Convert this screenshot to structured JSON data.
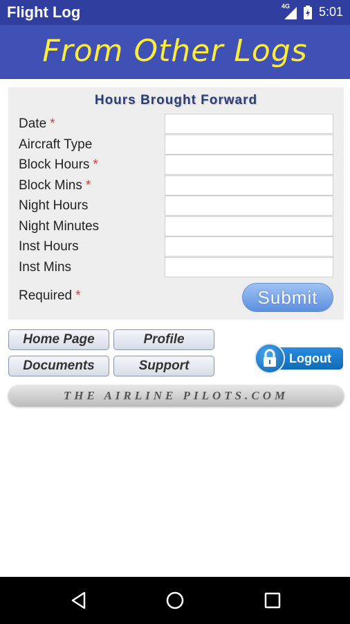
{
  "status_bar": {
    "app_title": "Flight Log",
    "network": "4G",
    "time": "5:01"
  },
  "banner": {
    "title": "From Other Logs"
  },
  "form": {
    "heading": "Hours Brought Forward",
    "fields": [
      {
        "label": "Date",
        "required_mark": "*",
        "value": ""
      },
      {
        "label": "Aircraft Type",
        "required_mark": "",
        "value": ""
      },
      {
        "label": "Block Hours",
        "required_mark": "*",
        "value": ""
      },
      {
        "label": "Block Mins",
        "required_mark": "*",
        "value": ""
      },
      {
        "label": "Night Hours",
        "required_mark": "",
        "value": ""
      },
      {
        "label": "Night Minutes",
        "required_mark": "",
        "value": ""
      },
      {
        "label": "Inst Hours",
        "required_mark": "",
        "value": ""
      },
      {
        "label": "Inst Mins",
        "required_mark": "",
        "value": ""
      }
    ],
    "required_note": "Required",
    "required_mark": "*",
    "submit_label": "Submit"
  },
  "nav": {
    "home": "Home Page",
    "profile": "Profile",
    "documents": "Documents",
    "support": "Support",
    "logout": "Logout"
  },
  "brand": {
    "text": "THE AIRLINE PILOTS.COM"
  },
  "colors": {
    "status_bar": "#303f9f",
    "banner": "#3f51b5",
    "banner_text": "#ffeb3b",
    "required": "#e53935"
  },
  "icons": {
    "signal": "signal-icon",
    "battery": "battery-icon",
    "lock": "lock-icon",
    "back": "back-icon",
    "home": "home-icon",
    "recents": "recents-icon"
  }
}
